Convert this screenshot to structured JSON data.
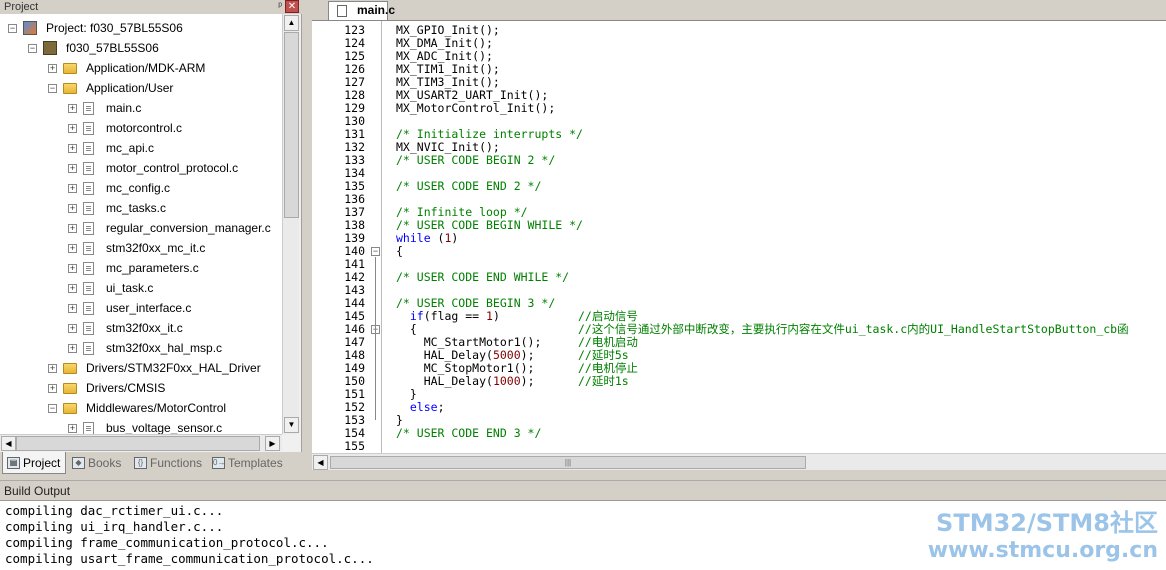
{
  "project_panel": {
    "title": "Project",
    "pin_glyph": "ᵖ",
    "close_glyph": "✕",
    "tree": [
      {
        "label": "Project: f030_57BL55S06",
        "level": 0,
        "type": "project",
        "expander": "−"
      },
      {
        "label": "f030_57BL55S06",
        "level": 1,
        "type": "target",
        "expander": "−"
      },
      {
        "label": "Application/MDK-ARM",
        "level": 2,
        "type": "folder",
        "expander": "+"
      },
      {
        "label": "Application/User",
        "level": 2,
        "type": "folder",
        "expander": "−"
      },
      {
        "label": "main.c",
        "level": 3,
        "type": "file",
        "expander": "+"
      },
      {
        "label": "motorcontrol.c",
        "level": 3,
        "type": "file",
        "expander": "+"
      },
      {
        "label": "mc_api.c",
        "level": 3,
        "type": "file",
        "expander": "+"
      },
      {
        "label": "motor_control_protocol.c",
        "level": 3,
        "type": "file",
        "expander": "+"
      },
      {
        "label": "mc_config.c",
        "level": 3,
        "type": "file",
        "expander": "+"
      },
      {
        "label": "mc_tasks.c",
        "level": 3,
        "type": "file",
        "expander": "+"
      },
      {
        "label": "regular_conversion_manager.c",
        "level": 3,
        "type": "file",
        "expander": "+"
      },
      {
        "label": "stm32f0xx_mc_it.c",
        "level": 3,
        "type": "file",
        "expander": "+"
      },
      {
        "label": "mc_parameters.c",
        "level": 3,
        "type": "file",
        "expander": "+"
      },
      {
        "label": "ui_task.c",
        "level": 3,
        "type": "file",
        "expander": "+"
      },
      {
        "label": "user_interface.c",
        "level": 3,
        "type": "file",
        "expander": "+"
      },
      {
        "label": "stm32f0xx_it.c",
        "level": 3,
        "type": "file",
        "expander": "+"
      },
      {
        "label": "stm32f0xx_hal_msp.c",
        "level": 3,
        "type": "file",
        "expander": "+"
      },
      {
        "label": "Drivers/STM32F0xx_HAL_Driver",
        "level": 2,
        "type": "folder",
        "expander": "+"
      },
      {
        "label": "Drivers/CMSIS",
        "level": 2,
        "type": "folder",
        "expander": "+"
      },
      {
        "label": "Middlewares/MotorControl",
        "level": 2,
        "type": "folder",
        "expander": "−"
      },
      {
        "label": "bus_voltage_sensor.c",
        "level": 3,
        "type": "file",
        "expander": "+"
      }
    ],
    "tabs": [
      {
        "label": "Project",
        "icon": "project-icon",
        "glyph": "▤",
        "active": true
      },
      {
        "label": "Books",
        "icon": "books-icon",
        "glyph": "◆",
        "active": false
      },
      {
        "label": "Functions",
        "icon": "functions-icon",
        "glyph": "{}",
        "active": false
      },
      {
        "label": "Templates",
        "icon": "templates-icon",
        "glyph": "0→",
        "active": false
      }
    ]
  },
  "editor": {
    "tab_label": "main.c",
    "lines": [
      {
        "n": "123",
        "t": "MX_GPIO_Init();",
        "c": ""
      },
      {
        "n": "124",
        "t": "MX_DMA_Init();",
        "c": ""
      },
      {
        "n": "125",
        "t": "MX_ADC_Init();",
        "c": ""
      },
      {
        "n": "126",
        "t": "MX_TIM1_Init();",
        "c": ""
      },
      {
        "n": "127",
        "t": "MX_TIM3_Init();",
        "c": ""
      },
      {
        "n": "128",
        "t": "MX_USART2_UART_Init();",
        "c": ""
      },
      {
        "n": "129",
        "t": "MX_MotorControl_Init();",
        "c": ""
      },
      {
        "n": "130",
        "t": "",
        "c": ""
      },
      {
        "n": "131",
        "t": "/* Initialize interrupts */",
        "c": "cm"
      },
      {
        "n": "132",
        "t": "MX_NVIC_Init();",
        "c": ""
      },
      {
        "n": "133",
        "t": "/* USER CODE BEGIN 2 */",
        "c": "cm"
      },
      {
        "n": "134",
        "t": "",
        "c": ""
      },
      {
        "n": "135",
        "t": "/* USER CODE END 2 */",
        "c": "cm"
      },
      {
        "n": "136",
        "t": "",
        "c": ""
      },
      {
        "n": "137",
        "t": "/* Infinite loop */",
        "c": "cm"
      },
      {
        "n": "138",
        "t": "/* USER CODE BEGIN WHILE */",
        "c": "cm"
      },
      {
        "n": "139",
        "t": "while (1)",
        "c": "while"
      },
      {
        "n": "140",
        "t": "{",
        "c": ""
      },
      {
        "n": "141",
        "t": "",
        "c": ""
      },
      {
        "n": "142",
        "t": "/* USER CODE END WHILE */",
        "c": "cm"
      },
      {
        "n": "143",
        "t": "",
        "c": ""
      },
      {
        "n": "144",
        "t": "/* USER CODE BEGIN 3 */",
        "c": "cm"
      },
      {
        "n": "145",
        "t": "  if(flag == 1)",
        "c": "if",
        "r": "//启动信号"
      },
      {
        "n": "146",
        "t": "  {",
        "c": "",
        "r": "//这个信号通过外部中断改变，主要执行内容在文件ui_task.c内的UI_HandleStartStopButton_cb函"
      },
      {
        "n": "147",
        "t": "    MC_StartMotor1();",
        "c": "",
        "r": "//电机启动"
      },
      {
        "n": "148",
        "t": "    HAL_Delay(5000);",
        "c": "delay",
        "r": "//延时5s"
      },
      {
        "n": "149",
        "t": "    MC_StopMotor1();",
        "c": "",
        "r": "//电机停止"
      },
      {
        "n": "150",
        "t": "    HAL_Delay(1000);",
        "c": "delay",
        "r": "//延时1s"
      },
      {
        "n": "151",
        "t": "  }",
        "c": ""
      },
      {
        "n": "152",
        "t": "  else;",
        "c": "else"
      },
      {
        "n": "153",
        "t": "}",
        "c": ""
      },
      {
        "n": "154",
        "t": "/* USER CODE END 3 */",
        "c": "cm"
      },
      {
        "n": "155",
        "t": "",
        "c": ""
      }
    ],
    "scroll_grip": "|||"
  },
  "build_output": {
    "title": "Build Output",
    "lines": [
      "compiling dac_rctimer_ui.c...",
      "compiling ui_irq_handler.c...",
      "compiling frame_communication_protocol.c...",
      "compiling usart_frame_communication_protocol.c..."
    ]
  },
  "watermark": {
    "line1": "STM32/STM8社区",
    "line2": "www.stmcu.org.cn"
  },
  "colors": {
    "keyword": "#0000ff",
    "comment": "#008000",
    "number": "#800000"
  }
}
